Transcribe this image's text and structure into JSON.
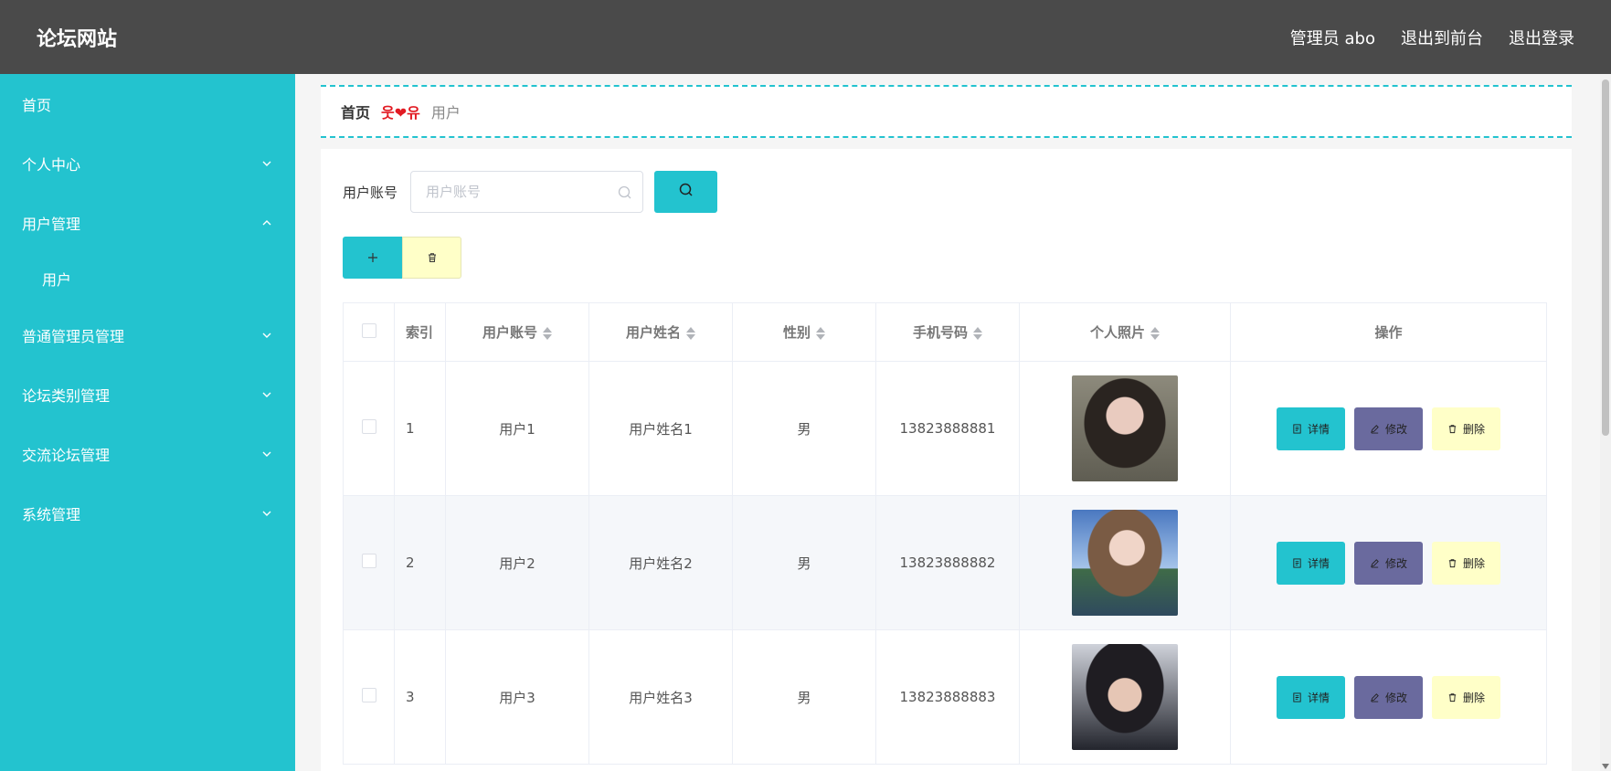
{
  "header": {
    "brand": "论坛网站",
    "admin_label": "管理员 abo",
    "to_front": "退出到前台",
    "logout": "退出登录"
  },
  "sidebar": {
    "items": [
      {
        "label": "首页",
        "icon": "none"
      },
      {
        "label": "个人中心",
        "icon": "chevron-down-icon"
      },
      {
        "label": "用户管理",
        "icon": "chevron-up-icon"
      },
      {
        "label": "用户",
        "icon": "none"
      },
      {
        "label": "普通管理员管理",
        "icon": "chevron-down-icon"
      },
      {
        "label": "论坛类别管理",
        "icon": "chevron-down-icon"
      },
      {
        "label": "交流论坛管理",
        "icon": "chevron-down-icon"
      },
      {
        "label": "系统管理",
        "icon": "chevron-down-icon"
      }
    ]
  },
  "breadcrumb": {
    "home": "首页",
    "separator": "웃❤유",
    "current": "用户"
  },
  "search": {
    "label": "用户账号",
    "placeholder": "用户账号"
  },
  "table": {
    "headers": [
      "索引",
      "用户账号",
      "用户姓名",
      "性别",
      "手机号码",
      "个人照片",
      "操作"
    ],
    "rows": [
      {
        "index": "1",
        "account": "用户1",
        "name": "用户姓名1",
        "gender": "男",
        "phone": "13823888881"
      },
      {
        "index": "2",
        "account": "用户2",
        "name": "用户姓名2",
        "gender": "男",
        "phone": "13823888882"
      },
      {
        "index": "3",
        "account": "用户3",
        "name": "用户姓名3",
        "gender": "男",
        "phone": "13823888883"
      }
    ],
    "ops": {
      "detail": "详情",
      "edit": "修改",
      "delete": "删除"
    }
  },
  "colors": {
    "accent": "#23c3cf",
    "header_bg": "#4a4a4a",
    "edit_btn": "#6a6a9e",
    "delete_btn": "#ffffc8"
  }
}
